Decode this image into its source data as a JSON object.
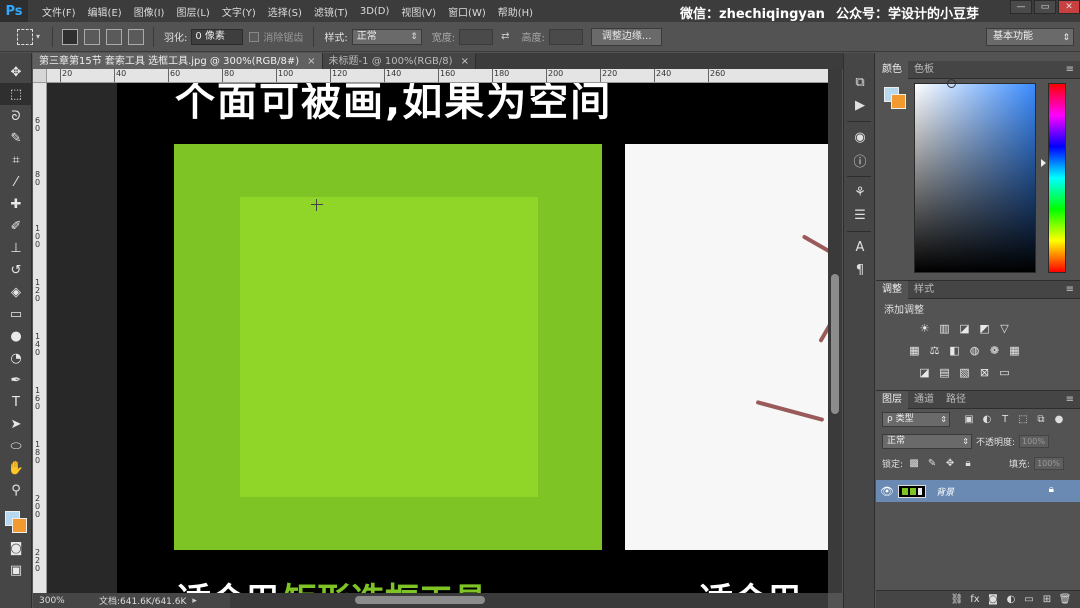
{
  "app": {
    "logo": "Ps"
  },
  "menu": [
    "文件(F)",
    "编辑(E)",
    "图像(I)",
    "图层(L)",
    "文字(Y)",
    "选择(S)",
    "滤镜(T)",
    "3D(D)",
    "视图(V)",
    "窗口(W)",
    "帮助(H)"
  ],
  "watermark": {
    "wechat": "微信：zhechiqingyan",
    "account": "公众号：学设计的小豆芽"
  },
  "window_buttons": {
    "minimize": "—",
    "restore": "▭",
    "close": "✕"
  },
  "options": {
    "feather_label": "羽化:",
    "feather_value": "0 像素",
    "antialias_label": "消除锯齿",
    "style_label": "样式:",
    "style_value": "正常",
    "width_label": "宽度:",
    "height_label": "高度:",
    "refine_button": "调整边缘...",
    "workspace": "基本功能"
  },
  "tabs": [
    {
      "label": "第三章第15节 套索工具 选框工具.jpg @ 300%(RGB/8#)",
      "close": "×"
    },
    {
      "label": "未标题-1 @ 100%(RGB/8)",
      "close": "×"
    }
  ],
  "ruler": {
    "top": [
      "20",
      "40",
      "60",
      "80",
      "100",
      "120",
      "140",
      "160",
      "180",
      "200",
      "220",
      "240",
      "260"
    ],
    "left": [
      "60",
      "80",
      "100",
      "120",
      "140",
      "160",
      "180",
      "200",
      "220"
    ]
  },
  "canvas": {
    "top_text": "个面可被画,如果为空间",
    "bottom_white_1": "适合用",
    "bottom_green": "矩形选框工具",
    "bottom_white_2": "适合用"
  },
  "status": {
    "zoom": "300%",
    "doc_size": "文档:641.6K/641.6K",
    "arrow": "▸"
  },
  "color_panel": {
    "tabs": [
      "颜色",
      "色板"
    ]
  },
  "adjust_panel": {
    "tabs": [
      "调整",
      "样式"
    ],
    "title": "添加调整"
  },
  "layers_panel": {
    "tabs": [
      "图层",
      "通道",
      "路径"
    ],
    "filter_label": "ρ 类型",
    "blend_mode": "正常",
    "opacity_label": "不透明度:",
    "opacity_value": "100%",
    "lock_label": "锁定:",
    "fill_label": "填充:",
    "fill_value": "100%",
    "layer_name": "背景"
  },
  "colors": {
    "foreground": "#b8d8f0",
    "background": "#f09a30",
    "green": "#7ec425",
    "layer_highlight": "#6a8ab4"
  }
}
